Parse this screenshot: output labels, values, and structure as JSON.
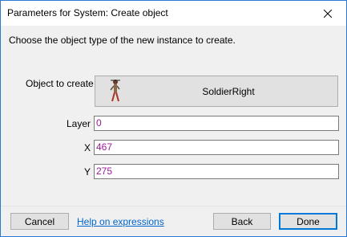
{
  "window": {
    "title": "Parameters for System: Create object"
  },
  "instruction": "Choose the object type of the new instance to create.",
  "fields": {
    "object": {
      "label": "Object to create",
      "value": "SoldierRight"
    },
    "layer": {
      "label": "Layer",
      "value": "0"
    },
    "x": {
      "label": "X",
      "value": "467"
    },
    "y": {
      "label": "Y",
      "value": "275"
    }
  },
  "footer": {
    "cancel_label": "Cancel",
    "help_link": "Help on expressions",
    "back_label": "Back",
    "done_label": "Done"
  },
  "colors": {
    "value_text": "#9a1a9a",
    "link": "#0066cc",
    "accent": "#0078d7"
  }
}
